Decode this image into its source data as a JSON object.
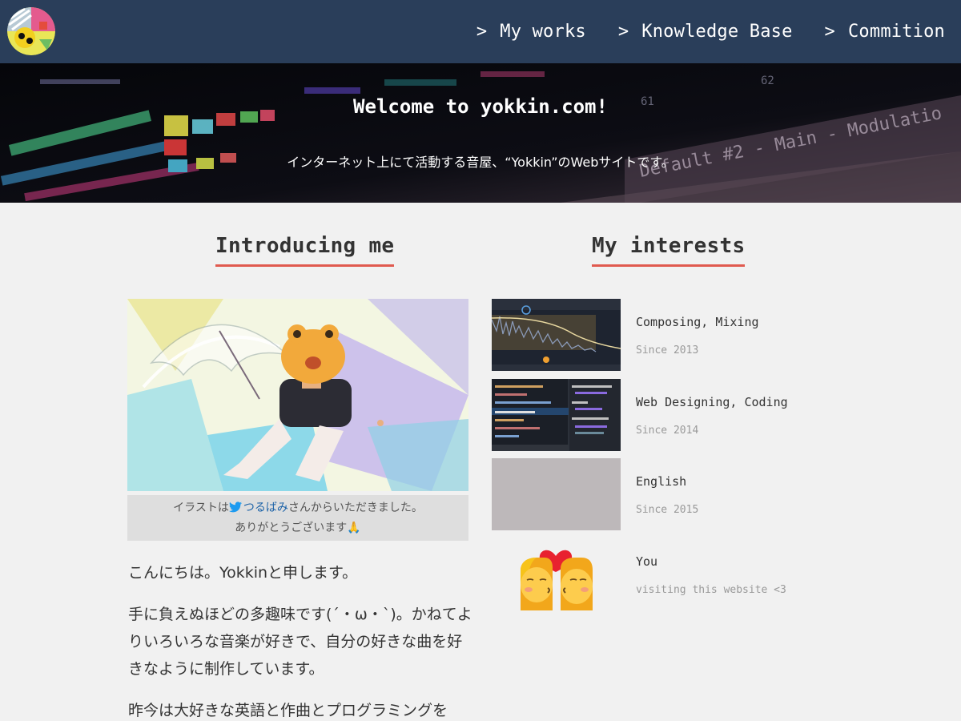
{
  "nav": {
    "links": [
      {
        "chevron": ">",
        "label": "My works"
      },
      {
        "chevron": ">",
        "label": "Knowledge Base"
      },
      {
        "chevron": ">",
        "label": "Commition"
      }
    ]
  },
  "hero": {
    "title": "Welcome to yokkin.com!",
    "subtitle": "インターネット上にて活動する音屋、“Yokkin”のWebサイトです。",
    "background_text": [
      "Default #2 - Main - Modulatio",
      "61",
      "62"
    ]
  },
  "intro": {
    "heading": "Introducing me",
    "caption_line1_prefix": "イラストは",
    "caption_artist": "つるばみ",
    "caption_line1_suffix": "さんからいただきました。",
    "caption_line2": "ありがとうございます🙏",
    "paragraphs": [
      "こんにちは。Yokkinと申します。",
      "手に負えぬほどの多趣味です(´・ω・`)。かねてよりいろいろな音楽が好きで、自分の好きな曲を好きなように制作しています。",
      "昨今は大好きな英語と作曲とプログラミングを"
    ]
  },
  "interests": {
    "heading": "My interests",
    "items": [
      {
        "name": "Composing, Mixing",
        "since": "Since 2013",
        "thumb": "spectrum-analyzer-screenshot"
      },
      {
        "name": "Web Designing, Coding",
        "since": "Since 2014",
        "thumb": "code-editor-screenshot"
      },
      {
        "name": "English",
        "since": "Since 2015",
        "thumb": "blank-placeholder"
      },
      {
        "name": "You",
        "since": "visiting this website <3",
        "thumb": "kiss-emoji"
      }
    ]
  },
  "colors": {
    "navbar": "#2a3e5a",
    "accent_underline": "#e05a4f",
    "page_background": "#f1f1f1",
    "caption_background": "#dedede",
    "link": "#1d63a8"
  }
}
